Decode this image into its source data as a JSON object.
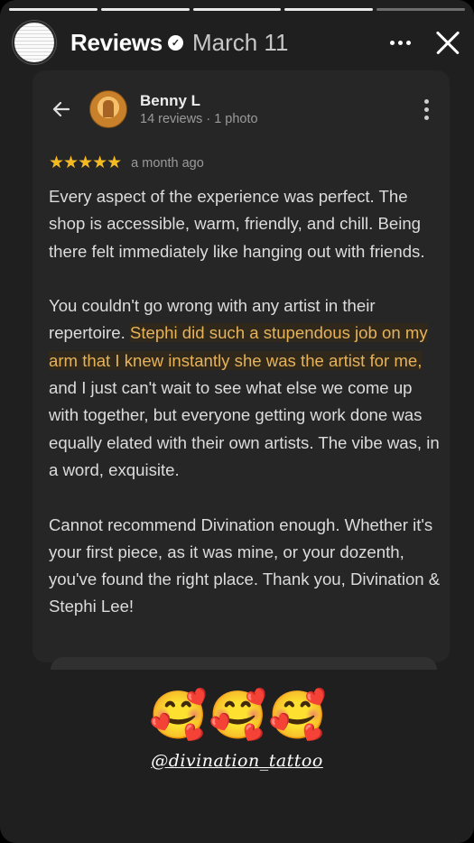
{
  "story": {
    "progress_segments": 5,
    "completed_segments": 4,
    "title": "Reviews",
    "verified_glyph": "✓",
    "date": "March 11"
  },
  "review": {
    "reviewer_name": "Benny L",
    "reviewer_meta": "14 reviews · 1 photo",
    "stars": "★★★★★",
    "rating": 5,
    "age": "a month ago",
    "paragraph1": "Every aspect of the experience was perfect. The shop is accessible, warm, friendly, and chill. Being there felt immediately like hanging out with friends.",
    "paragraph2_pre": "You couldn't go wrong with any artist in their repertoire. ",
    "paragraph2_highlight": "Stephi did such a stupendous job on my arm that I knew instantly she was the artist for me,",
    "paragraph2_post": " and I just can't wait to see what else we come up with together, but everyone getting work done was equally elated with their own artists. The vibe was, in a word, exquisite.",
    "paragraph3": "Cannot recommend Divination enough. Whether it's your first piece, as it was mine, or your dozenth, you've found the right place. Thank you, Divination & Stephi Lee!"
  },
  "overlay": {
    "emojis": [
      "🥰",
      "🥰",
      "🥰"
    ],
    "mention": "@divination_tattoo"
  },
  "colors": {
    "accent_star": "#f5b921",
    "highlight_text": "#e6b25a",
    "card_bg": "#262626"
  },
  "icons": [
    "verified-badge-icon",
    "more-horizontal-icon",
    "close-icon",
    "back-arrow-icon",
    "more-vertical-icon",
    "smiling-face-with-hearts-emoji"
  ]
}
